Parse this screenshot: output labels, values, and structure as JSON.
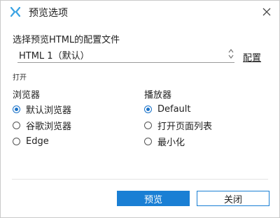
{
  "window": {
    "title": "预览选项"
  },
  "config": {
    "label": "选择预览HTML的配置文件",
    "selected_value": "HTML 1（默认）",
    "config_link": "配置"
  },
  "open_section": {
    "label": "打开"
  },
  "browser_group": {
    "title": "浏览器",
    "options": [
      {
        "label": "默认浏览器",
        "selected": true
      },
      {
        "label": "谷歌浏览器",
        "selected": false
      },
      {
        "label": "Edge",
        "selected": false
      }
    ]
  },
  "player_group": {
    "title": "播放器",
    "options": [
      {
        "label": "Default",
        "selected": true
      },
      {
        "label": "打开页面列表",
        "selected": false
      },
      {
        "label": "最小化",
        "selected": false
      }
    ]
  },
  "buttons": {
    "preview": "预览",
    "close": "关闭"
  },
  "colors": {
    "accent": "#1a7fd4"
  },
  "icons": {
    "app": "app-logo-icon",
    "close": "close-icon",
    "spinner": "updown-arrows-icon"
  }
}
